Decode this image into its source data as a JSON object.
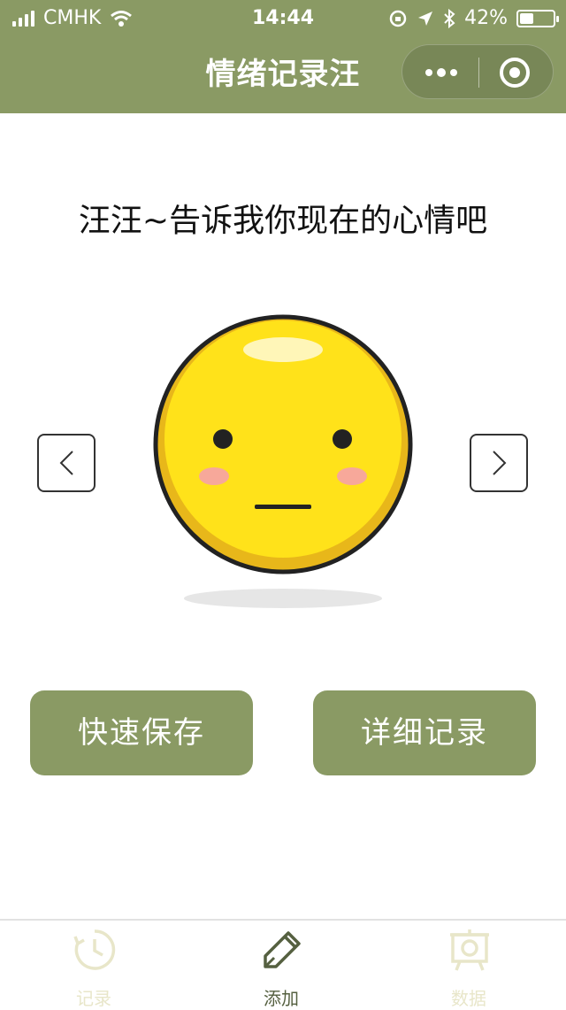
{
  "status_bar": {
    "carrier": "CMHK",
    "time": "14:44",
    "battery": "42%",
    "battery_level": 0.42
  },
  "nav": {
    "title": "情绪记录汪"
  },
  "main": {
    "prompt": "汪汪~告诉我你现在的心情吧",
    "quick_save_label": "快速保存",
    "detail_record_label": "详细记录"
  },
  "tabs": [
    {
      "label": "记录",
      "icon": "clock-history-icon",
      "active": false
    },
    {
      "label": "添加",
      "icon": "pen-icon",
      "active": true
    },
    {
      "label": "数据",
      "icon": "chart-board-icon",
      "active": false
    }
  ],
  "colors": {
    "theme": "#8a9a64",
    "face_yellow": "#ffe21a",
    "cheek": "#f7a89a"
  }
}
